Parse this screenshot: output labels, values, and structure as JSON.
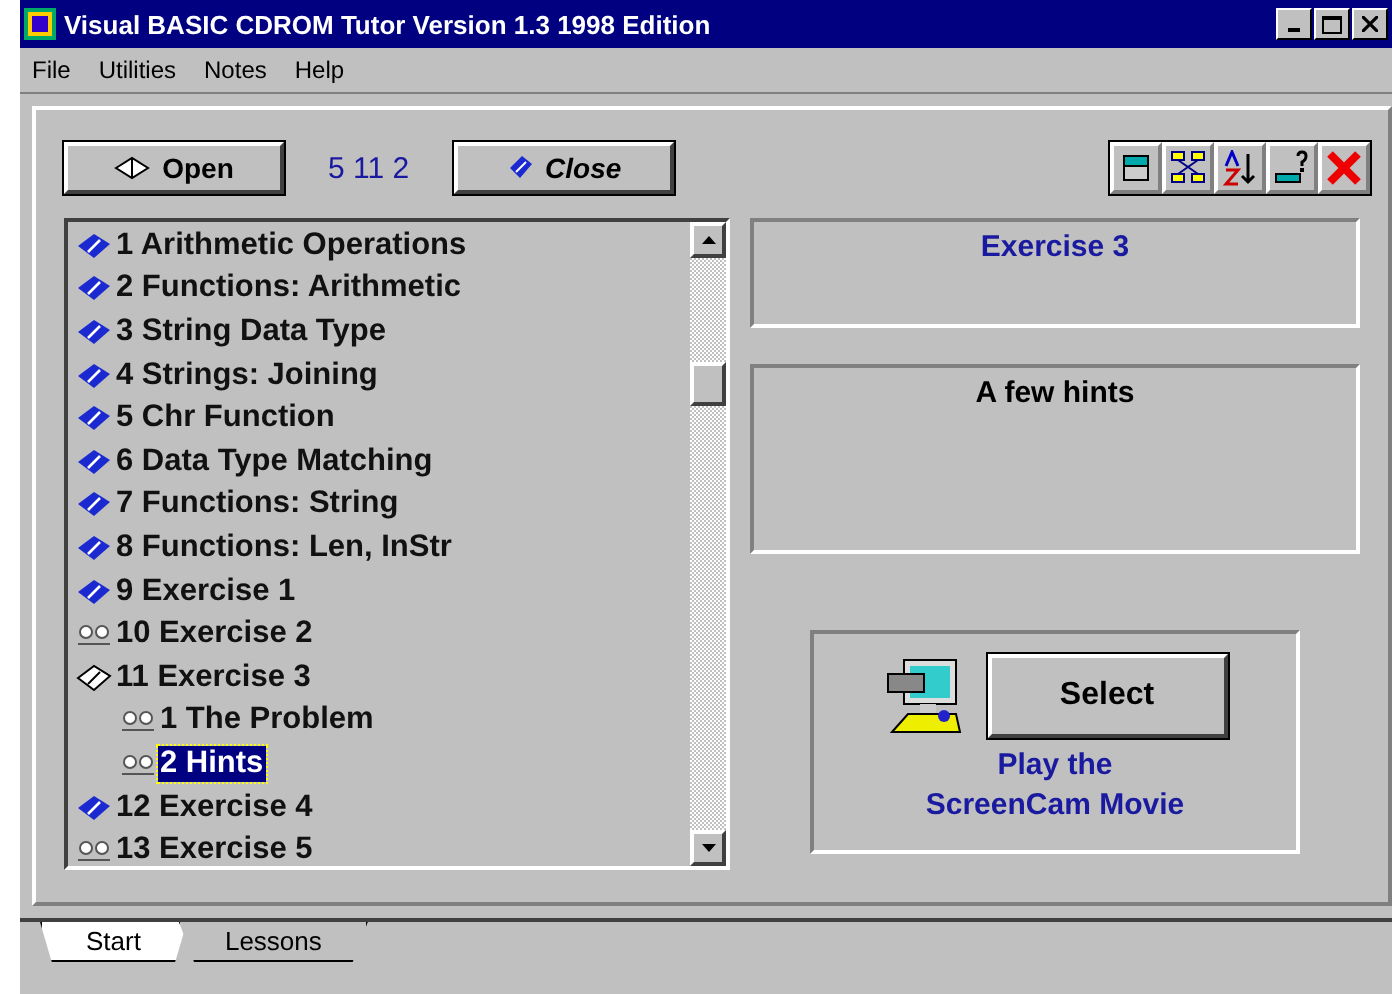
{
  "window": {
    "title": "Visual BASIC CDROM Tutor Version 1.3 1998 Edition"
  },
  "menu": [
    "File",
    "Utilities",
    "Notes",
    "Help"
  ],
  "toolbar": {
    "open": "Open",
    "counter": "5 11 2",
    "close": "Close",
    "tools": [
      {
        "kind": "stack"
      },
      {
        "kind": "diagram"
      },
      {
        "kind": "sort"
      },
      {
        "kind": "question"
      },
      {
        "kind": "delete"
      }
    ]
  },
  "tree": [
    {
      "label": "1 Arithmetic Operations",
      "kind": "book",
      "selected": false
    },
    {
      "label": "2 Functions: Arithmetic",
      "kind": "book",
      "selected": false
    },
    {
      "label": "3 String Data Type",
      "kind": "book",
      "selected": false
    },
    {
      "label": "4 Strings: Joining",
      "kind": "book",
      "selected": false
    },
    {
      "label": "5 Chr Function",
      "kind": "book",
      "selected": false
    },
    {
      "label": "6 Data Type Matching",
      "kind": "book",
      "selected": false
    },
    {
      "label": "7 Functions: String",
      "kind": "book",
      "selected": false
    },
    {
      "label": "8 Functions: Len, InStr",
      "kind": "book",
      "selected": false
    },
    {
      "label": "9 Exercise 1",
      "kind": "book",
      "selected": false
    },
    {
      "label": "10 Exercise 2",
      "kind": "page",
      "selected": false
    },
    {
      "label": "11 Exercise 3",
      "kind": "open-book",
      "selected": false,
      "children": [
        {
          "label": "1 The Problem",
          "kind": "page",
          "selected": false
        },
        {
          "label": "2 Hints",
          "kind": "page",
          "selected": true
        }
      ]
    },
    {
      "label": "12 Exercise 4",
      "kind": "book",
      "selected": false
    },
    {
      "label": "13 Exercise 5",
      "kind": "page",
      "selected": false
    }
  ],
  "title_panel": "Exercise 3",
  "description_panel": "A few hints",
  "movie": {
    "button": "Select",
    "caption": [
      "Play the",
      "ScreenCam Movie"
    ]
  },
  "tabs": [
    {
      "label": "Start",
      "selected": true
    },
    {
      "label": "Lessons",
      "selected": false
    }
  ]
}
